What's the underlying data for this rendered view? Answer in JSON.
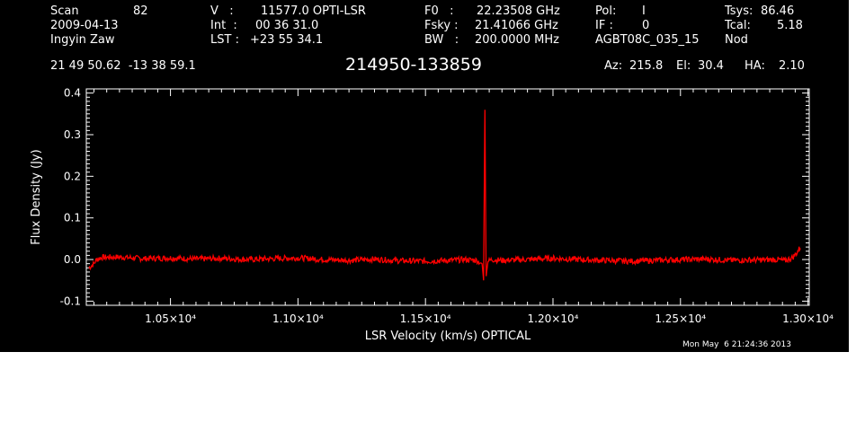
{
  "header": {
    "scan_label": "Scan",
    "scan_value": "82",
    "date": "2009-04-13",
    "observer": "Ingyin Zaw",
    "v_label": "V   :",
    "v_value": "11577.0 OPTI-LSR",
    "int_label": "Int  :",
    "int_value": "00 36 31.0",
    "lst_label": "LST :",
    "lst_value": "+23 55 34.1",
    "f0_label": "F0   :",
    "f0_value": "22.23508 GHz",
    "fsky_label": "Fsky :",
    "fsky_value": "21.41066 GHz",
    "bw_label": "BW   :",
    "bw_value": "200.0000 MHz",
    "pol_label": "Pol:",
    "pol_value": "I",
    "if_label": "IF :",
    "if_value": "0",
    "project": "AGBT08C_035_15",
    "tsys_label": "Tsys:",
    "tsys_value": "86.46",
    "tcal_label": "Tcal:",
    "tcal_value": "5.18",
    "mode": "Nod",
    "coords": "21 49 50.62  -13 38 59.1",
    "source": "214950-133859",
    "az_label": "Az:",
    "az_value": "215.8",
    "el_label": "El:",
    "el_value": "30.4",
    "ha_label": "HA:",
    "ha_value": "2.10"
  },
  "footer": {
    "timestamp": "Mon May  6 21:24:36 2013"
  },
  "colors": {
    "background": "#000000",
    "trace": "#ff0000",
    "axes": "#ffffff"
  },
  "chart_data": {
    "type": "line",
    "title": "214950-133859",
    "xlabel": "LSR Velocity (km/s) OPTICAL",
    "ylabel": "Flux Density (Jy)",
    "xlim": [
      10170,
      13005
    ],
    "ylim": [
      -0.11,
      0.41
    ],
    "xticks": [
      10500,
      11000,
      11500,
      12000,
      12500,
      13000
    ],
    "xtick_labels": [
      "1.05×10⁴",
      "1.10×10⁴",
      "1.15×10⁴",
      "1.20×10⁴",
      "1.25×10⁴",
      "1.30×10⁴"
    ],
    "yticks": [
      -0.1,
      0.0,
      0.1,
      0.2,
      0.3,
      0.4
    ],
    "ytick_labels": [
      "-0.1",
      "0.0",
      "0.1",
      "0.2",
      "0.3",
      "0.4"
    ],
    "grid": false,
    "series": [
      {
        "color": "#ff0000",
        "x": [
          10180,
          10200,
          10210,
          10230,
          10300,
          10400,
          10500,
          10600,
          10700,
          10800,
          10900,
          11000,
          11100,
          11200,
          11300,
          11400,
          11500,
          11600,
          11650,
          11700,
          11722,
          11728,
          11733,
          11738,
          11745,
          11760,
          11800,
          11900,
          12000,
          12100,
          12200,
          12300,
          12400,
          12500,
          12600,
          12700,
          12800,
          12880,
          12910,
          12940,
          12955,
          12970
        ],
        "y": [
          -0.02,
          -0.01,
          0.0,
          0.005,
          0.006,
          0.002,
          0.004,
          0.001,
          0.003,
          0.0,
          0.002,
          0.004,
          0.0,
          -0.002,
          0.001,
          -0.003,
          -0.004,
          -0.002,
          0.0,
          -0.002,
          -0.01,
          -0.05,
          0.36,
          -0.04,
          -0.005,
          0.0,
          -0.002,
          0.0,
          0.003,
          0.0,
          -0.002,
          -0.004,
          -0.002,
          0.0,
          0.001,
          -0.002,
          -0.001,
          0.0,
          -0.003,
          0.005,
          0.015,
          0.03
        ]
      }
    ]
  }
}
